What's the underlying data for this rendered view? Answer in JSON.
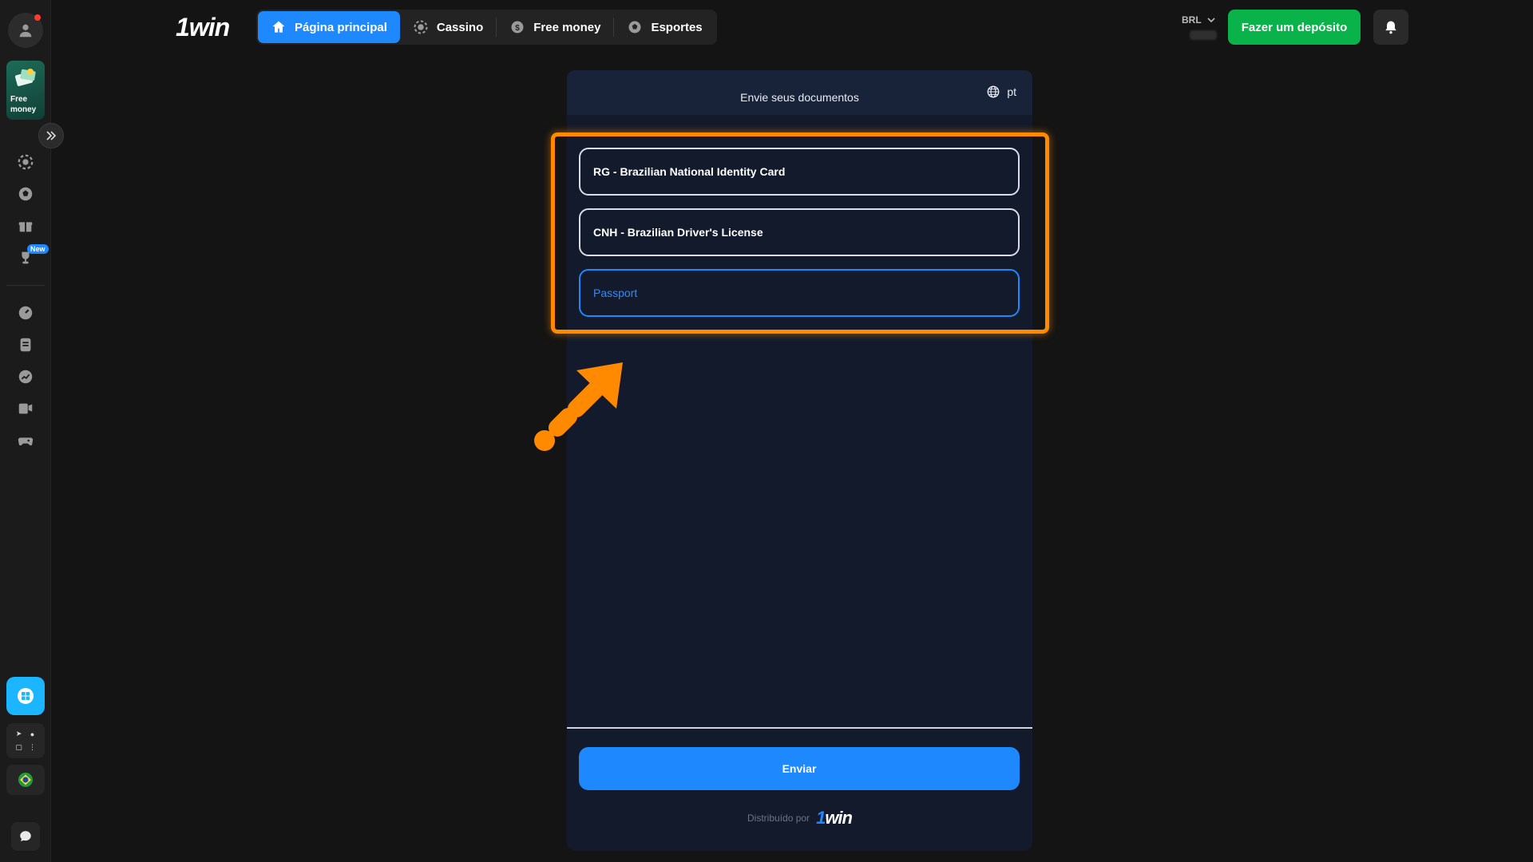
{
  "sidebar": {
    "promo_label_1": "Free",
    "promo_label_2": "money",
    "new_badge": "New"
  },
  "header": {
    "logo": "1win",
    "nav": [
      {
        "label": "Página principal",
        "icon": "home-icon",
        "active": true
      },
      {
        "label": "Cassino",
        "icon": "casino-chip-icon"
      },
      {
        "label": "Free money",
        "icon": "dollar-coin-icon"
      },
      {
        "label": "Esportes",
        "icon": "soccer-ball-icon"
      }
    ],
    "currency": "BRL",
    "deposit_label": "Fazer um depósito"
  },
  "panel": {
    "title": "Envie seus documentos",
    "language": "pt",
    "options": [
      {
        "label": "RG - Brazilian National Identity Card"
      },
      {
        "label": "CNH - Brazilian Driver's License"
      },
      {
        "label": "Passport",
        "selected": true
      }
    ],
    "submit_label": "Enviar",
    "powered_by": "Distribuído por",
    "powered_logo": "1win"
  },
  "colors": {
    "accent": "#1e88ff",
    "deposit": "#0ab24a",
    "annotation": "#ff8a00",
    "panel_bg": "#121a2b"
  }
}
